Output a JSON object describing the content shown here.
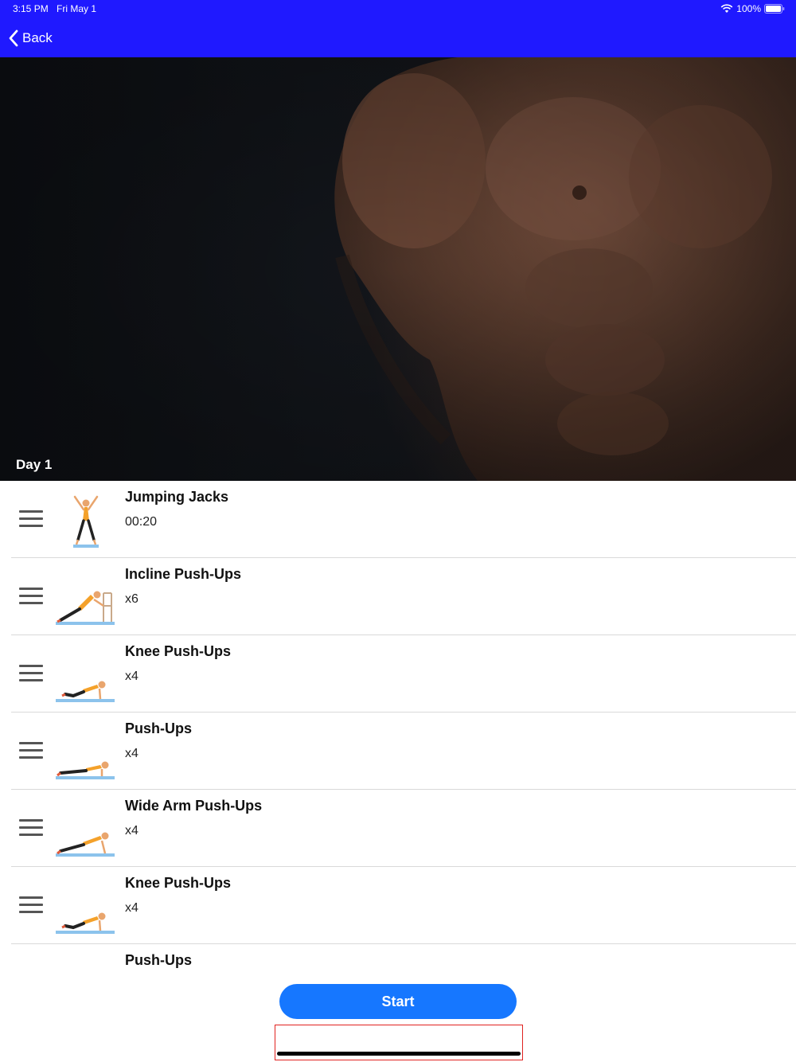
{
  "status_bar": {
    "time": "3:15 PM",
    "date": "Fri May 1",
    "battery": "100%"
  },
  "nav": {
    "back_label": "Back"
  },
  "hero": {
    "day_label": "Day 1"
  },
  "exercises": [
    {
      "name": "Jumping Jacks",
      "detail": "00:20",
      "icon": "jumping-jacks-illustration"
    },
    {
      "name": "Incline Push-Ups",
      "detail": "x6",
      "icon": "incline-push-up-illustration"
    },
    {
      "name": "Knee Push-Ups",
      "detail": "x4",
      "icon": "knee-push-up-illustration"
    },
    {
      "name": "Push-Ups",
      "detail": "x4",
      "icon": "push-up-illustration"
    },
    {
      "name": "Wide Arm Push-Ups",
      "detail": "x4",
      "icon": "wide-arm-push-up-illustration"
    },
    {
      "name": "Knee Push-Ups",
      "detail": "x4",
      "icon": "knee-push-up-illustration"
    },
    {
      "name": "Push-Ups",
      "detail": "",
      "icon": "push-up-illustration"
    }
  ],
  "start_button": {
    "label": "Start"
  },
  "colors": {
    "nav_bar": "#1f19ff",
    "start_button": "#1677ff",
    "mat": "#8cc3ec",
    "shirt": "#f4a12a"
  }
}
